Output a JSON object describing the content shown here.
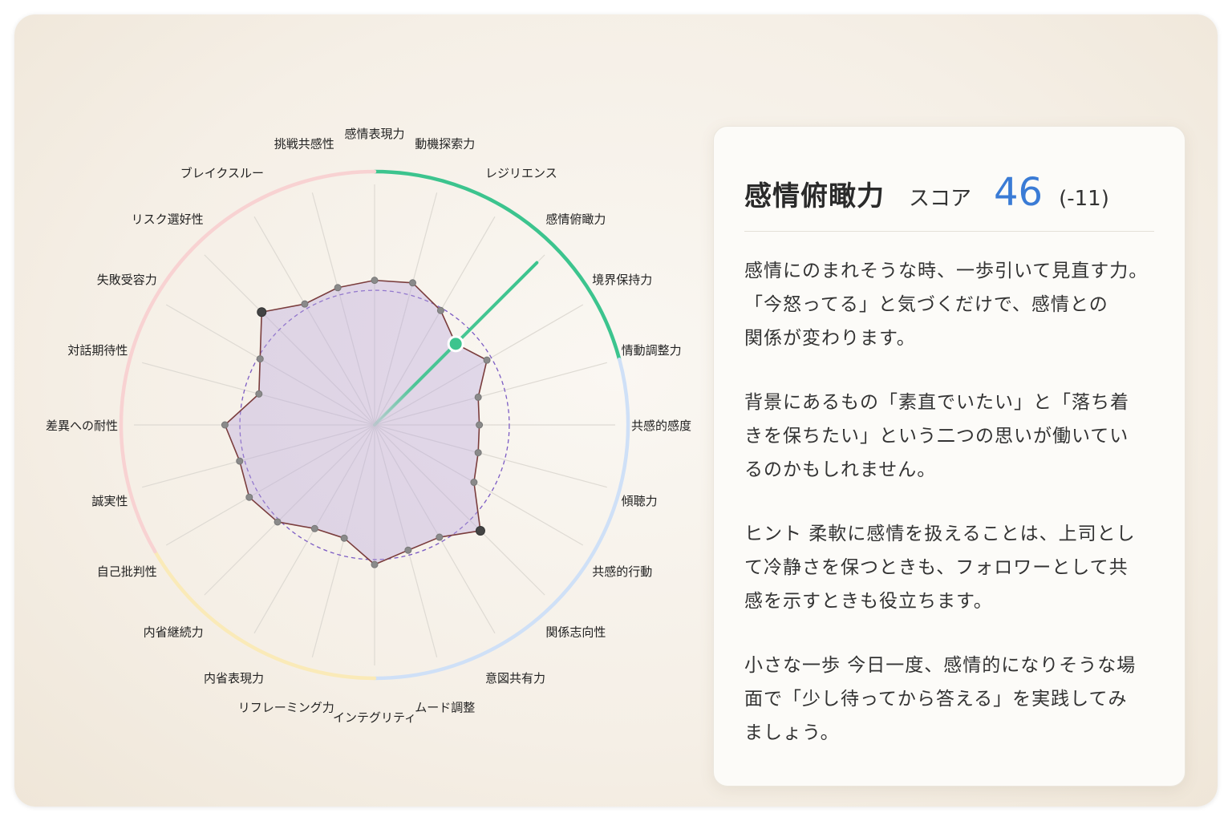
{
  "radar": {
    "axes": [
      "感情表現力",
      "動機探索力",
      "レジリエンス",
      "感情俯瞰力",
      "境界保持力",
      "情動調整力",
      "共感的感度",
      "傾聴力",
      "共感的行動",
      "関係志向性",
      "意図共有力",
      "ムード調整",
      "インテグリティ",
      "リフレーミング力",
      "内省表現力",
      "内省継続力",
      "自己批判性",
      "誠実性",
      "差異への耐性",
      "対話期待性",
      "失敗受容力",
      "リスク選好性",
      "ブレイクスルー",
      "挑戦共感性"
    ],
    "scores": [
      58,
      59,
      53,
      46,
      52,
      43,
      42,
      43,
      46,
      60,
      52,
      52,
      56,
      47,
      48,
      55,
      58,
      56,
      60,
      48,
      53,
      64,
      56,
      57
    ],
    "highlighted_scores": [
      false,
      false,
      false,
      true,
      false,
      false,
      false,
      false,
      false,
      true,
      false,
      false,
      false,
      false,
      false,
      false,
      false,
      false,
      false,
      false,
      false,
      true,
      false,
      false
    ],
    "baseline_score": 54,
    "max_score": 100,
    "selected_axis": "感情俯瞰力",
    "arc_groups": [
      {
        "from": "感情表現力",
        "to": "情動調整力",
        "color": "#3cc48e"
      },
      {
        "from": "情動調整力",
        "to": "インテグリティ",
        "color": "#cfe0f7"
      },
      {
        "from": "インテグリティ",
        "to": "自己批判性",
        "color": "#faeab8"
      },
      {
        "from": "自己批判性",
        "to": "感情表現力",
        "color": "#f8d2d2"
      }
    ],
    "colors": {
      "fill": "#b9a6dc",
      "stroke": "#7a3d3d",
      "baseline": "#7c5cc4",
      "accent": "#3cc48e"
    }
  },
  "panel": {
    "title": "感情俯瞰力",
    "score_label": "スコア",
    "score": "46",
    "diff": "(-11)",
    "paragraphs": [
      "感情にのまれそうな時、一歩引いて見直す力。\n「今怒ってる」と気づくだけで、感情との\n関係が変わります。",
      "背景にあるもの「素直でいたい」と「落ち着\nきを保ちたい」という二つの思いが働いてい\nるのかもしれません。",
      "ヒント 柔軟に感情を扱えることは、上司とし\nて冷静さを保つときも、フォロワーとして共\n感を示すときも役立ちます。",
      "小さな一歩 今日一度、感情的になりそうな場\n面で「少し待ってから答える」を実践してみ\nましょう。"
    ]
  }
}
